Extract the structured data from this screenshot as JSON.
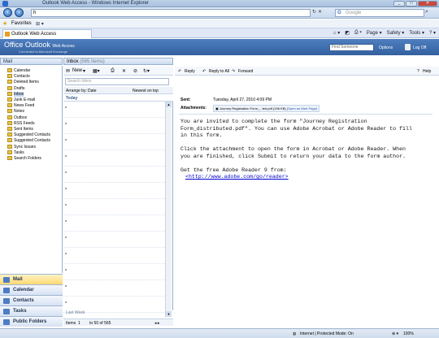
{
  "window": {
    "title": "Outlook Web Access - Windows Internet Explorer"
  },
  "ie": {
    "address": "h",
    "search_placeholder": "Google",
    "favorites_label": "Favorites",
    "tab_title": "Outlook Web Access",
    "commands": [
      "Page ▾",
      "Safety ▾",
      "Tools ▾"
    ]
  },
  "owa": {
    "product": "Office Outlook",
    "product_suffix": "Web Access",
    "copyright": "Connected to Microsoft Exchange",
    "find_someone": "Find Someone",
    "options": "Options",
    "logoff": "Log Off"
  },
  "nav": {
    "header": "Mail",
    "folders": [
      {
        "label": "Calendar",
        "indent": 1
      },
      {
        "label": "Contacts",
        "indent": 1
      },
      {
        "label": "Deleted Items",
        "indent": 1
      },
      {
        "label": "Drafts",
        "indent": 1
      },
      {
        "label": "Inbox",
        "indent": 1,
        "selected": true
      },
      {
        "label": "Junk E-mail",
        "indent": 1
      },
      {
        "label": "News Feed",
        "indent": 1
      },
      {
        "label": "Notes",
        "indent": 1
      },
      {
        "label": "Outbox",
        "indent": 1
      },
      {
        "label": "RSS Feeds",
        "indent": 1
      },
      {
        "label": "Sent Items",
        "indent": 1
      },
      {
        "label": "Suggested Contacts",
        "indent": 1
      },
      {
        "label": "Suggested Contacts",
        "indent": 1
      },
      {
        "label": "Sync Issues",
        "indent": 1
      },
      {
        "label": "Tasks",
        "indent": 1
      },
      {
        "label": "Search Folders",
        "indent": 1
      }
    ],
    "buttons": [
      "Mail",
      "Calendar",
      "Contacts",
      "Tasks",
      "Public Folders"
    ]
  },
  "list": {
    "title": "Inbox",
    "count": "(565 Items)",
    "new_label": "New",
    "search_placeholder": "Search Inbox",
    "arrange_label": "Arrange by:",
    "arrange_value": "Date",
    "order_label": "Newest on top",
    "group_today": "Today",
    "group_lastweek": "Last Week",
    "items_label": "Items",
    "items_page": "1",
    "items_range": "to 50 of 565"
  },
  "reading": {
    "actions": [
      "Reply",
      "Reply to All",
      "Forward"
    ],
    "help": "Help",
    "sent_label": "Sent:",
    "sent_value": "Tuesday, April 27, 2010 4:09 PM",
    "attachments_label": "Attachments:",
    "attachment_name": "Journey Registration Form_...ted.pdf (196 KB)",
    "attachment_link": "[Open as Web Page]",
    "body_lines": [
      "You are invited to complete the form \"Journey Registration",
      "Form_distributed.pdf\". You can use Adobe Acrobat or Adobe Reader to fill",
      "in this form.",
      "",
      "Click the attachment to open the form in Acrobat or Adobe Reader. When",
      "you are finished, click Submit to return your data to the form author.",
      "",
      "Get the free Adobe Reader 9 from:"
    ],
    "body_url": "<http://www.adobe.com/go/reader>"
  },
  "status": {
    "zone": "Internet | Protected Mode: On",
    "zoom": "100%"
  }
}
